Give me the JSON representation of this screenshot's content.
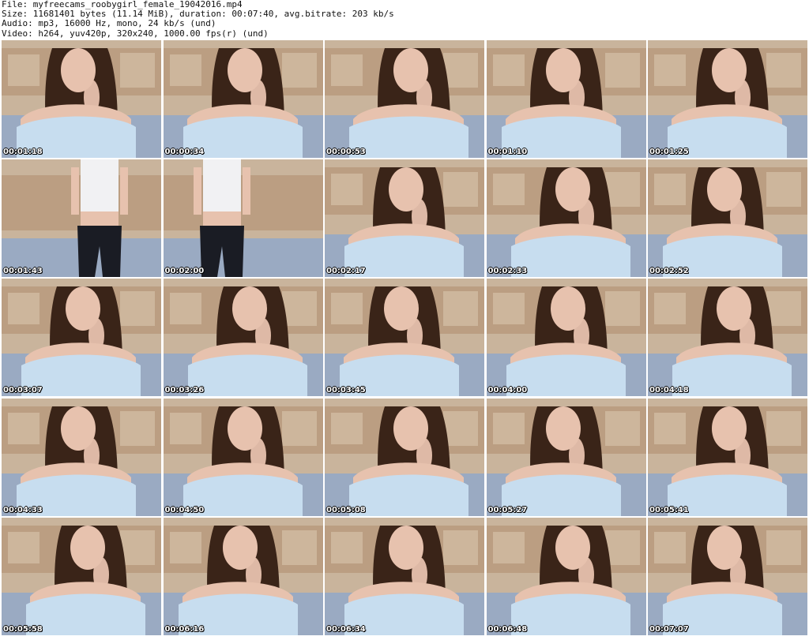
{
  "header": {
    "file": "File: myfreecams_roobygirl_female_19042016.mp4",
    "size": "Size: 11681401 bytes (11.14 MiB), duration: 00:07:40, avg.bitrate: 203 kb/s",
    "audio": "Audio: mp3, 16000 Hz, mono, 24 kb/s (und)",
    "video": "Video: h264, yuv420p, 320x240, 1000.00 fps(r) (und)"
  },
  "thumbnails": [
    {
      "timestamp": "00:01:18",
      "scene": "closeup"
    },
    {
      "timestamp": "00:00:34",
      "scene": "closeup"
    },
    {
      "timestamp": "00:00:53",
      "scene": "closeup"
    },
    {
      "timestamp": "00:01:10",
      "scene": "closeup"
    },
    {
      "timestamp": "00:01:25",
      "scene": "closeup"
    },
    {
      "timestamp": "00:01:43",
      "scene": "standing"
    },
    {
      "timestamp": "00:02:00",
      "scene": "standing"
    },
    {
      "timestamp": "00:02:17",
      "scene": "closeup"
    },
    {
      "timestamp": "00:02:33",
      "scene": "closeup"
    },
    {
      "timestamp": "00:02:52",
      "scene": "closeup"
    },
    {
      "timestamp": "00:03:07",
      "scene": "closeup"
    },
    {
      "timestamp": "00:03:26",
      "scene": "closeup"
    },
    {
      "timestamp": "00:03:45",
      "scene": "closeup"
    },
    {
      "timestamp": "00:04:00",
      "scene": "closeup"
    },
    {
      "timestamp": "00:04:18",
      "scene": "closeup"
    },
    {
      "timestamp": "00:04:33",
      "scene": "closeup"
    },
    {
      "timestamp": "00:04:50",
      "scene": "closeup"
    },
    {
      "timestamp": "00:05:08",
      "scene": "closeup"
    },
    {
      "timestamp": "00:05:27",
      "scene": "closeup"
    },
    {
      "timestamp": "00:05:41",
      "scene": "closeup"
    },
    {
      "timestamp": "00:05:58",
      "scene": "closeup"
    },
    {
      "timestamp": "00:06:16",
      "scene": "closeup"
    },
    {
      "timestamp": "00:06:34",
      "scene": "closeup"
    },
    {
      "timestamp": "00:06:48",
      "scene": "closeup"
    },
    {
      "timestamp": "00:07:07",
      "scene": "closeup"
    }
  ],
  "colors": {
    "wall": "#c9b49c",
    "couch": "#b89a7e",
    "bedding": "#8fa7cc",
    "hair": "#3a2418",
    "skin": "#e7c2ae",
    "shirt": "#c7ddef",
    "leggings": "#1a1c24"
  }
}
